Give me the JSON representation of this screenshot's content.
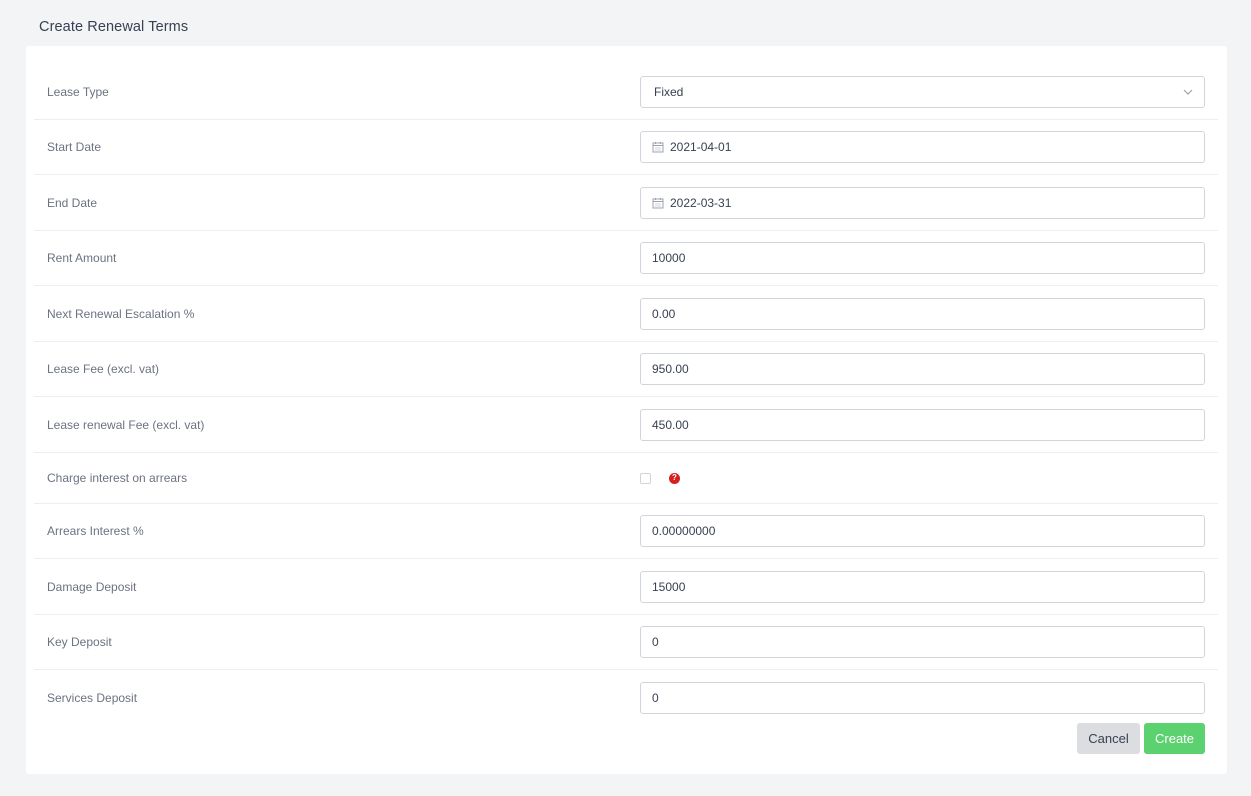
{
  "page": {
    "title": "Create Renewal Terms"
  },
  "form": {
    "lease_type": {
      "label": "Lease Type",
      "value": "Fixed"
    },
    "start_date": {
      "label": "Start Date",
      "value": "2021-04-01"
    },
    "end_date": {
      "label": "End Date",
      "value": "2022-03-31"
    },
    "rent_amount": {
      "label": "Rent Amount",
      "value": "10000"
    },
    "escalation": {
      "label": "Next Renewal Escalation %",
      "value": "0.00"
    },
    "lease_fee": {
      "label": "Lease Fee (excl. vat)",
      "value": "950.00"
    },
    "renewal_fee": {
      "label": "Lease renewal Fee (excl. vat)",
      "value": "450.00"
    },
    "charge_interest": {
      "label": "Charge interest on arrears",
      "help_icon": "?"
    },
    "arrears_interest": {
      "label": "Arrears Interest %",
      "value": "0.00000000"
    },
    "damage_deposit": {
      "label": "Damage Deposit",
      "value": "15000"
    },
    "key_deposit": {
      "label": "Key Deposit",
      "value": "0"
    },
    "services_deposit": {
      "label": "Services Deposit",
      "value": "0"
    }
  },
  "buttons": {
    "cancel": "Cancel",
    "create": "Create"
  }
}
